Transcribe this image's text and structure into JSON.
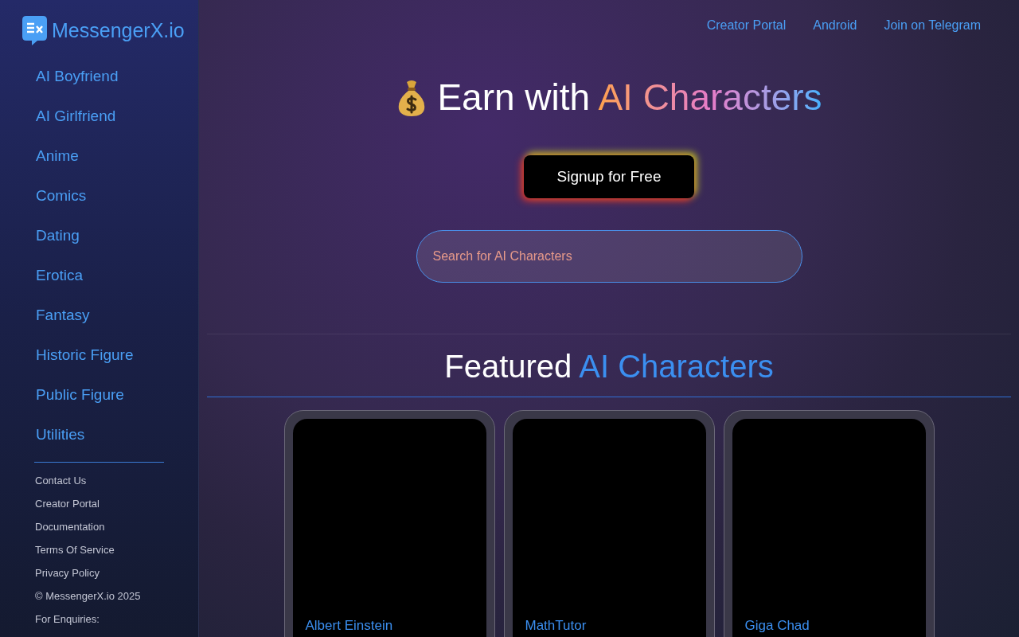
{
  "logo": {
    "text": "MessengerX.io"
  },
  "sidebar": {
    "categories": [
      "AI Boyfriend",
      "AI Girlfriend",
      "Anime",
      "Comics",
      "Dating",
      "Erotica",
      "Fantasy",
      "Historic Figure",
      "Public Figure",
      "Utilities"
    ],
    "footer_links": [
      "Contact Us",
      "Creator Portal",
      "Documentation",
      "Terms Of Service",
      "Privacy Policy",
      "© MessengerX.io 2025",
      "For Enquiries:"
    ]
  },
  "top_nav": [
    "Creator Portal",
    "Android",
    "Join on Telegram"
  ],
  "hero": {
    "title_plain": "Earn with",
    "title_highlight": "AI Characters",
    "signup_button": "Signup for Free",
    "search": {
      "placeholder": "Search for AI Characters"
    }
  },
  "featured": {
    "title_plain": "Featured",
    "title_highlight": "AI Characters",
    "cards": [
      {
        "name": "Albert Einstein"
      },
      {
        "name": "MathTutor"
      },
      {
        "name": "Giga Chad"
      }
    ]
  }
}
